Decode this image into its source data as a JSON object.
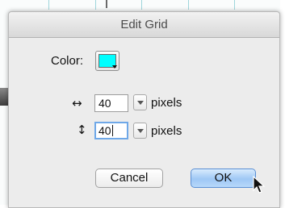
{
  "dialog": {
    "title": "Edit Grid",
    "color_label": "Color:",
    "color_value": "#00ffff",
    "width": {
      "icon": "horizontal-arrows-icon",
      "glyph": "↔",
      "value": "40",
      "unit": "pixels"
    },
    "height": {
      "icon": "vertical-arrows-icon",
      "glyph": "↕",
      "value": "40",
      "unit": "pixels"
    },
    "buttons": {
      "cancel": "Cancel",
      "ok": "OK"
    }
  },
  "colors": {
    "accent": "#6fa8e8",
    "ok_button": "#9ec7f5"
  }
}
